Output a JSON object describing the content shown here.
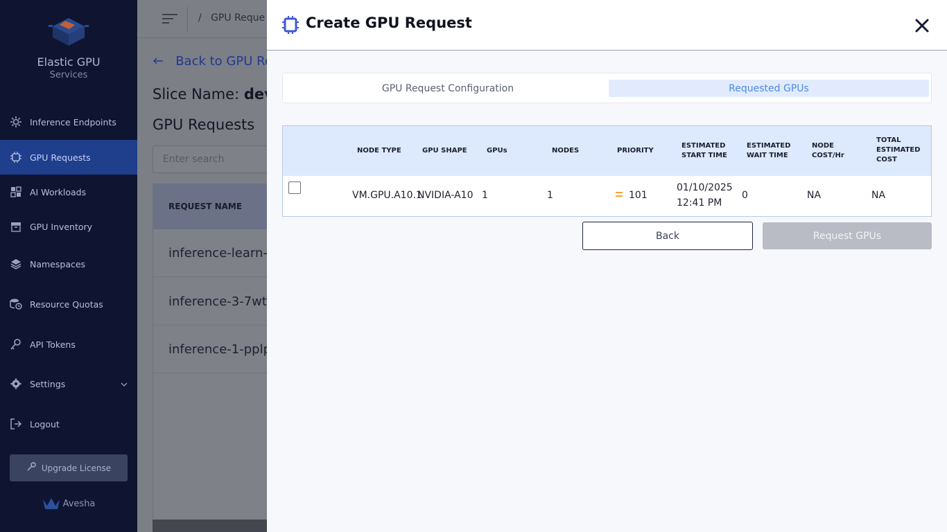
{
  "sidebar": {
    "brand_title": "Elastic GPU",
    "brand_sub": "Services",
    "items": [
      {
        "label": "Inference Endpoints",
        "icon": "gear-icon"
      },
      {
        "label": "GPU Requests",
        "icon": "chip-icon"
      },
      {
        "label": "AI Workloads",
        "icon": "grid-icon"
      },
      {
        "label": "GPU Inventory",
        "icon": "box-icon"
      },
      {
        "label": "Namespaces",
        "icon": "layers-icon"
      },
      {
        "label": "Resource Quotas",
        "icon": "database-clock-icon"
      },
      {
        "label": "API Tokens",
        "icon": "key-icon"
      },
      {
        "label": "Settings",
        "icon": "settings-icon"
      },
      {
        "label": "Logout",
        "icon": "logout-icon"
      }
    ],
    "upgrade_label": "Upgrade License",
    "footer_brand": "Avesha"
  },
  "background": {
    "breadcrumb_sep": "/",
    "breadcrumb": "GPU Reque",
    "back_link": "Back to GPU Re",
    "slice_label": "Slice Name: ",
    "slice_value": "dev",
    "section_title": "GPU Requests",
    "search_placeholder": "Enter search",
    "table_header": "REQUEST NAME",
    "rows": [
      "inference-learn-",
      "inference-3-7wt",
      "inference-1-pplp"
    ]
  },
  "modal": {
    "title": "Create GPU Request",
    "tabs": {
      "config": "GPU Request Configuration",
      "requested": "Requested GPUs"
    },
    "columns": {
      "node_type": "NODE TYPE",
      "gpu_shape": "GPU SHAPE",
      "gpus": "GPUs",
      "nodes": "NODES",
      "priority": "PRIORITY",
      "est_start_1": "ESTIMATED",
      "est_start_2": "START TIME",
      "est_wait_1": "ESTIMATED",
      "est_wait_2": "WAIT TIME",
      "node_cost_1": "NODE",
      "node_cost_2": "COST/Hr",
      "total_cost_1": "TOTAL",
      "total_cost_2": "ESTIMATED",
      "total_cost_3": "COST"
    },
    "row": {
      "node_type": "VM.GPU.A10.1",
      "gpu_shape": "NVIDIA-A10",
      "gpus": "1",
      "nodes": "1",
      "priority": "101",
      "start_date": "01/10/2025",
      "start_time": "12:41 PM",
      "wait_time": "0",
      "node_cost": "NA",
      "total_cost": "NA"
    },
    "back_button": "Back",
    "request_button": "Request GPUs"
  },
  "colors": {
    "sidebar_bg": "#0f1530",
    "active_item": "#1f3e8c",
    "accent_blue": "#4b8ae6",
    "priority_medium": "#f0a52a",
    "disabled_button": "#b9bcc4"
  }
}
